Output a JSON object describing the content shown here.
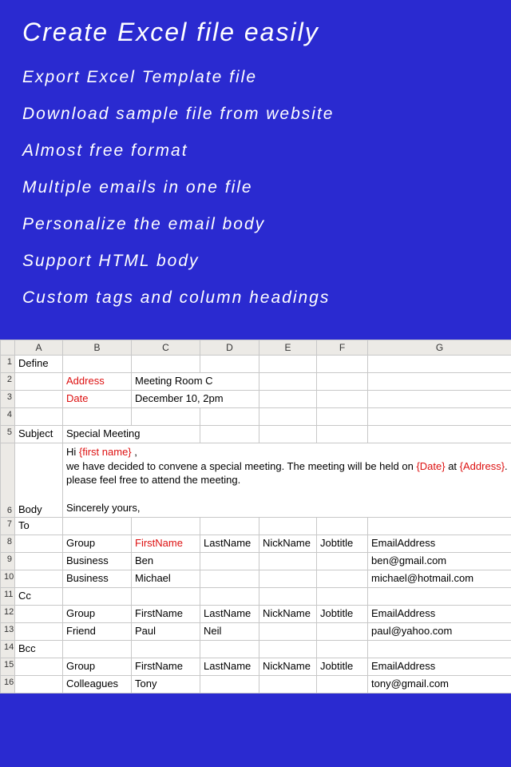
{
  "hero": {
    "title": "Create Excel file easily",
    "features": [
      "Export Excel Template file",
      "Download sample file from website",
      "Almost free format",
      "Multiple emails in one file",
      "Personalize the email body",
      "Support HTML body",
      "Custom tags and column headings"
    ]
  },
  "sheet": {
    "columns": [
      "A",
      "B",
      "C",
      "D",
      "E",
      "F",
      "G"
    ],
    "rows": {
      "1": {
        "A": "Define"
      },
      "2": {
        "B_red": "Address",
        "C": "Meeting Room C"
      },
      "3": {
        "B_red": "Date",
        "C": "December 10, 2pm"
      },
      "4": {},
      "5": {
        "A": "Subject",
        "B": "Special Meeting"
      },
      "6": {
        "A": "Body",
        "body": {
          "pre1": "Hi ",
          "tag1": "{first name}",
          "post1": " ,",
          "pre2": "we have decided to convene a special meeting.  The meeting will be held on ",
          "tag2": "{Date}",
          "mid2": " at ",
          "tag3": "{Address}",
          "post2": ".",
          "line3": "please feel free to attend the meeting.",
          "line4": "Sincerely yours,"
        }
      },
      "7": {
        "A": "To"
      },
      "8": {
        "B": "Group",
        "C_red": "FirstName",
        "D": "LastName",
        "E": "NickName",
        "F": "Jobtitle",
        "G": "EmailAddress"
      },
      "9": {
        "B": "Business",
        "C": "Ben",
        "G": "ben@gmail.com"
      },
      "10": {
        "B": "Business",
        "C": "Michael",
        "G": "michael@hotmail.com"
      },
      "11": {
        "A": "Cc"
      },
      "12": {
        "B": "Group",
        "C": "FirstName",
        "D": "LastName",
        "E": "NickName",
        "F": "Jobtitle",
        "G": "EmailAddress"
      },
      "13": {
        "B": "Friend",
        "C": "Paul",
        "D": "Neil",
        "G": "paul@yahoo.com"
      },
      "14": {
        "A": "Bcc"
      },
      "15": {
        "B": "Group",
        "C": "FirstName",
        "D": "LastName",
        "E": "NickName",
        "F": "Jobtitle",
        "G": "EmailAddress"
      },
      "16": {
        "B": "Colleagues",
        "C": "Tony",
        "G": "tony@gmail.com"
      }
    }
  }
}
